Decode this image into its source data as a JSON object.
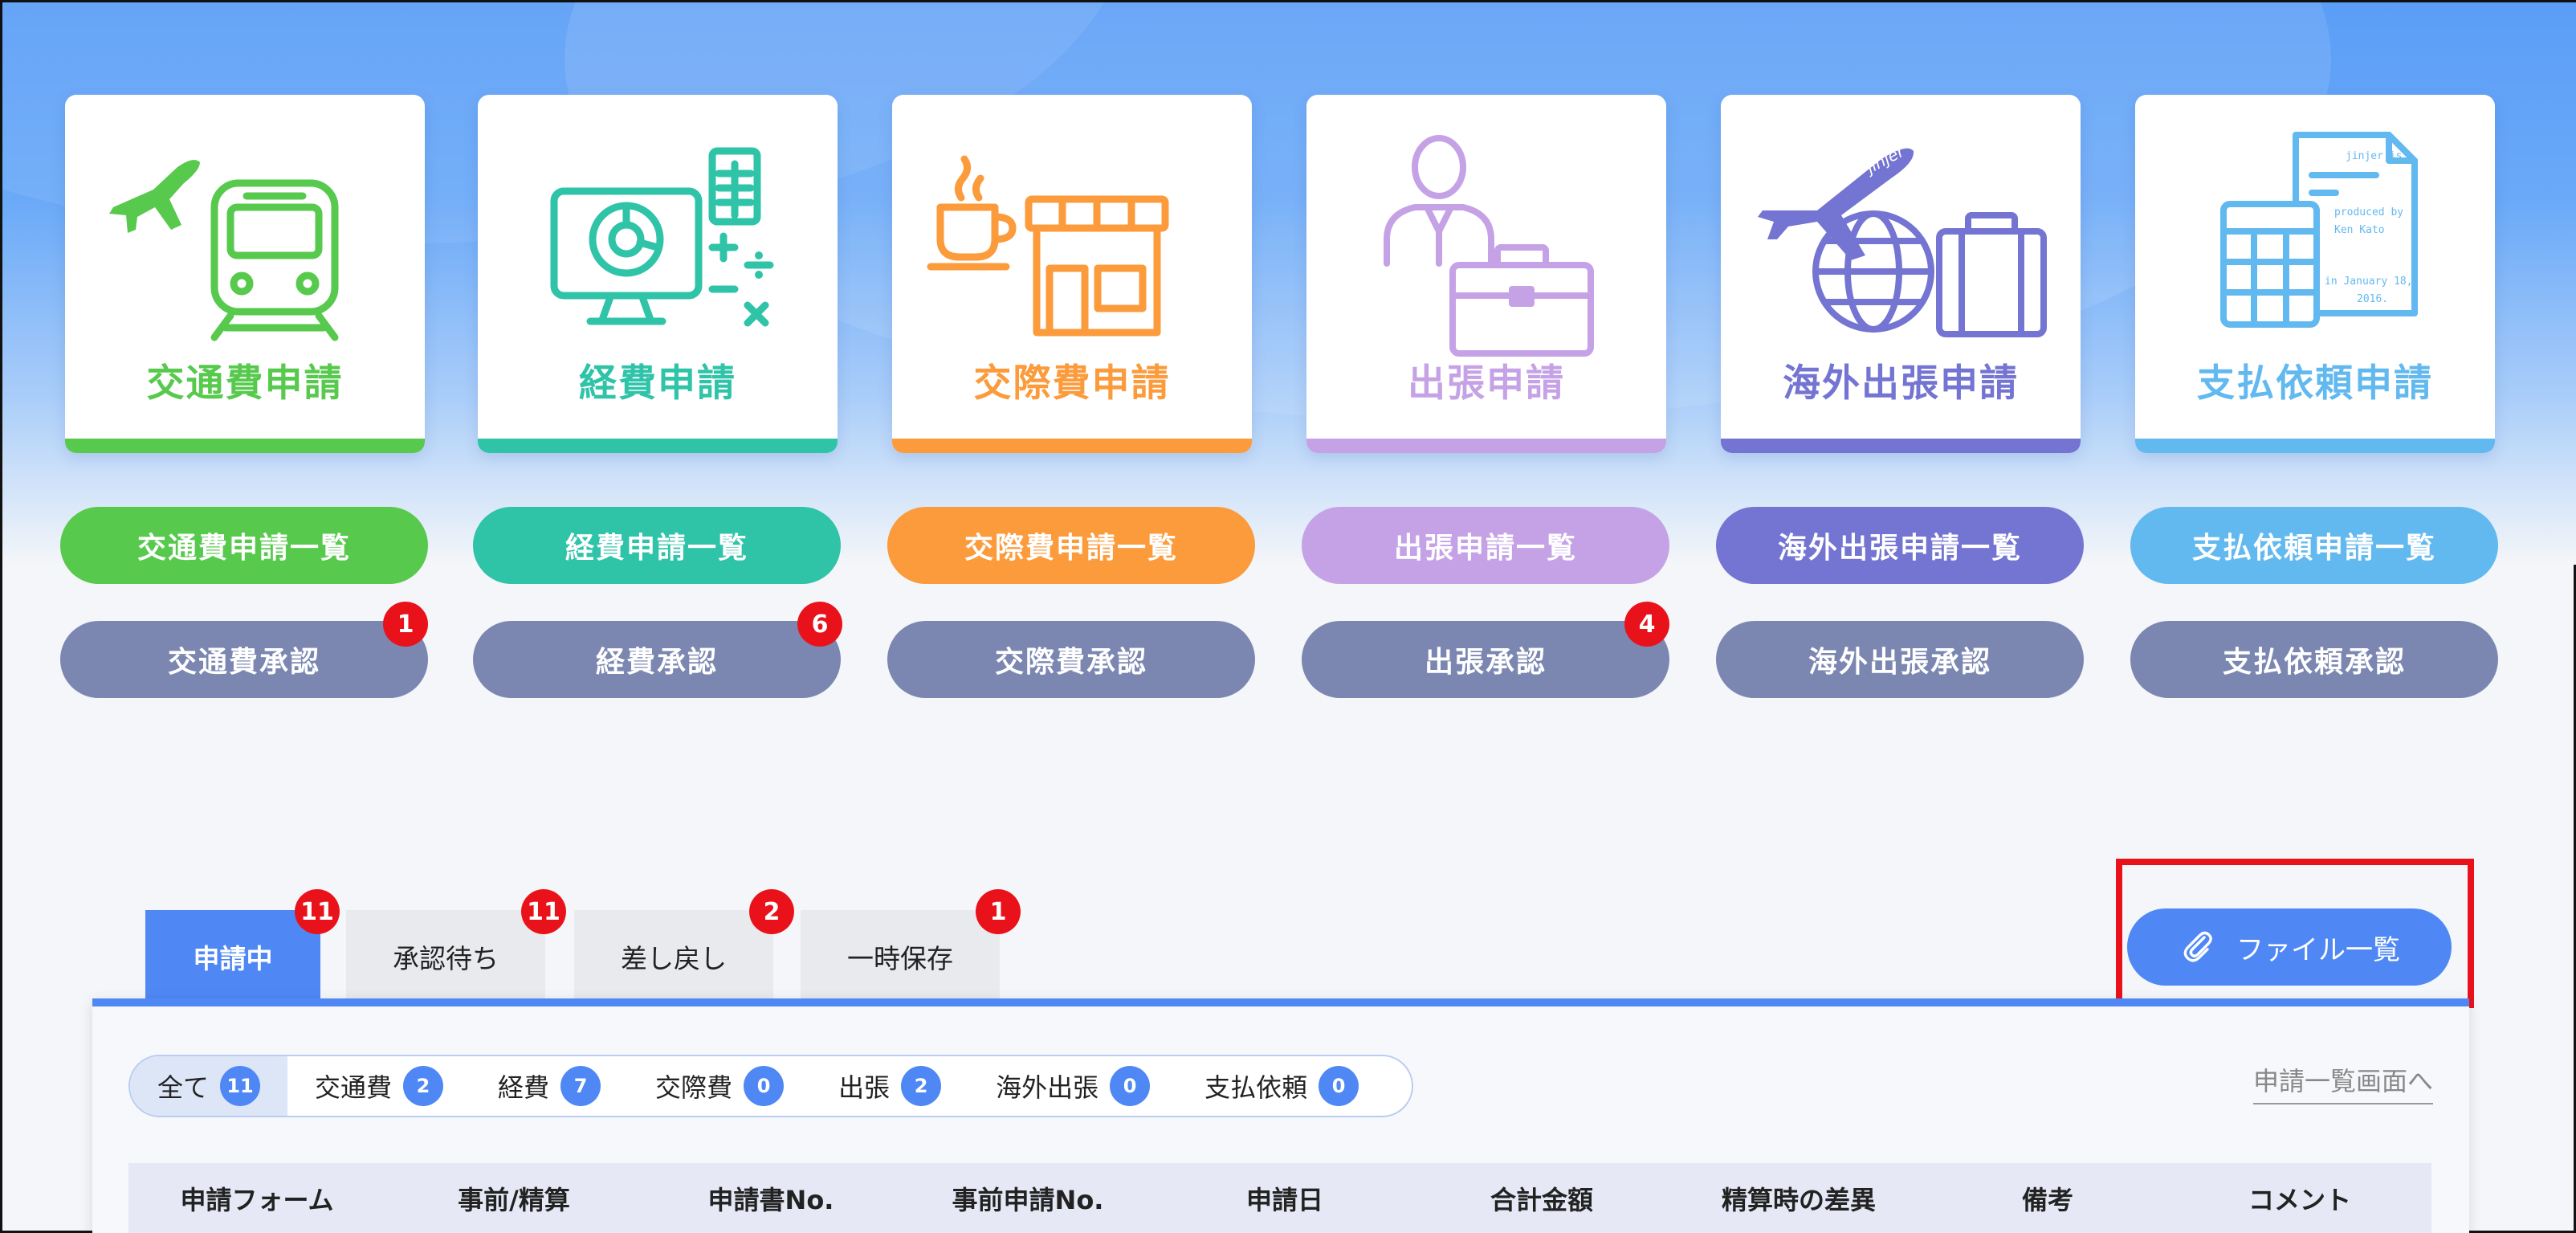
{
  "colors": {
    "green": "#57c94d",
    "teal": "#2fc3a8",
    "orange": "#fb9b3c",
    "lavender": "#c5a2e6",
    "indigo": "#7474d2",
    "sky": "#62b9ef",
    "approve": "#7b87b1",
    "primary": "#4f88f4",
    "badge": "#e9121b"
  },
  "cards": [
    {
      "label": "交通費申請",
      "icon": "train-plane-icon"
    },
    {
      "label": "経費申請",
      "icon": "monitor-calculator-icon"
    },
    {
      "label": "交際費申請",
      "icon": "coffee-shop-icon"
    },
    {
      "label": "出張申請",
      "icon": "businessman-briefcase-icon"
    },
    {
      "label": "海外出張申請",
      "icon": "plane-globe-suitcase-icon"
    },
    {
      "label": "支払依頼申請",
      "icon": "calculator-document-icon"
    }
  ],
  "list_buttons": [
    "交通費申請一覧",
    "経費申請一覧",
    "交際費申請一覧",
    "出張申請一覧",
    "海外出張申請一覧",
    "支払依頼申請一覧"
  ],
  "approve_buttons": [
    {
      "label": "交通費承認",
      "badge": "1"
    },
    {
      "label": "経費承認",
      "badge": "6"
    },
    {
      "label": "交際費承認",
      "badge": ""
    },
    {
      "label": "出張承認",
      "badge": "4"
    },
    {
      "label": "海外出張承認",
      "badge": ""
    },
    {
      "label": "支払依頼承認",
      "badge": ""
    }
  ],
  "tabs": [
    {
      "label": "申請中",
      "badge": "11"
    },
    {
      "label": "承認待ち",
      "badge": "11"
    },
    {
      "label": "差し戻し",
      "badge": "2"
    },
    {
      "label": "一時保存",
      "badge": "1"
    }
  ],
  "file_button": {
    "label": "ファイル一覧",
    "icon": "paperclip-icon"
  },
  "filters": [
    {
      "label": "全て",
      "count": "11"
    },
    {
      "label": "交通費",
      "count": "2"
    },
    {
      "label": "経費",
      "count": "7"
    },
    {
      "label": "交際費",
      "count": "0"
    },
    {
      "label": "出張",
      "count": "2"
    },
    {
      "label": "海外出張",
      "count": "0"
    },
    {
      "label": "支払依頼",
      "count": "0"
    }
  ],
  "list_link": "申請一覧画面へ",
  "table_headers": [
    "申請フォーム",
    "事前/精算",
    "申請書No.",
    "事前申請No.",
    "申請日",
    "合計金額",
    "精算時の差異",
    "備考",
    "コメント"
  ],
  "doc_text": {
    "line1": "jinjer is",
    "line2": "produced by",
    "line3": "Ken Kato",
    "line4": "in January 18,",
    "line5": "2016."
  },
  "plane_text": "jinjer"
}
